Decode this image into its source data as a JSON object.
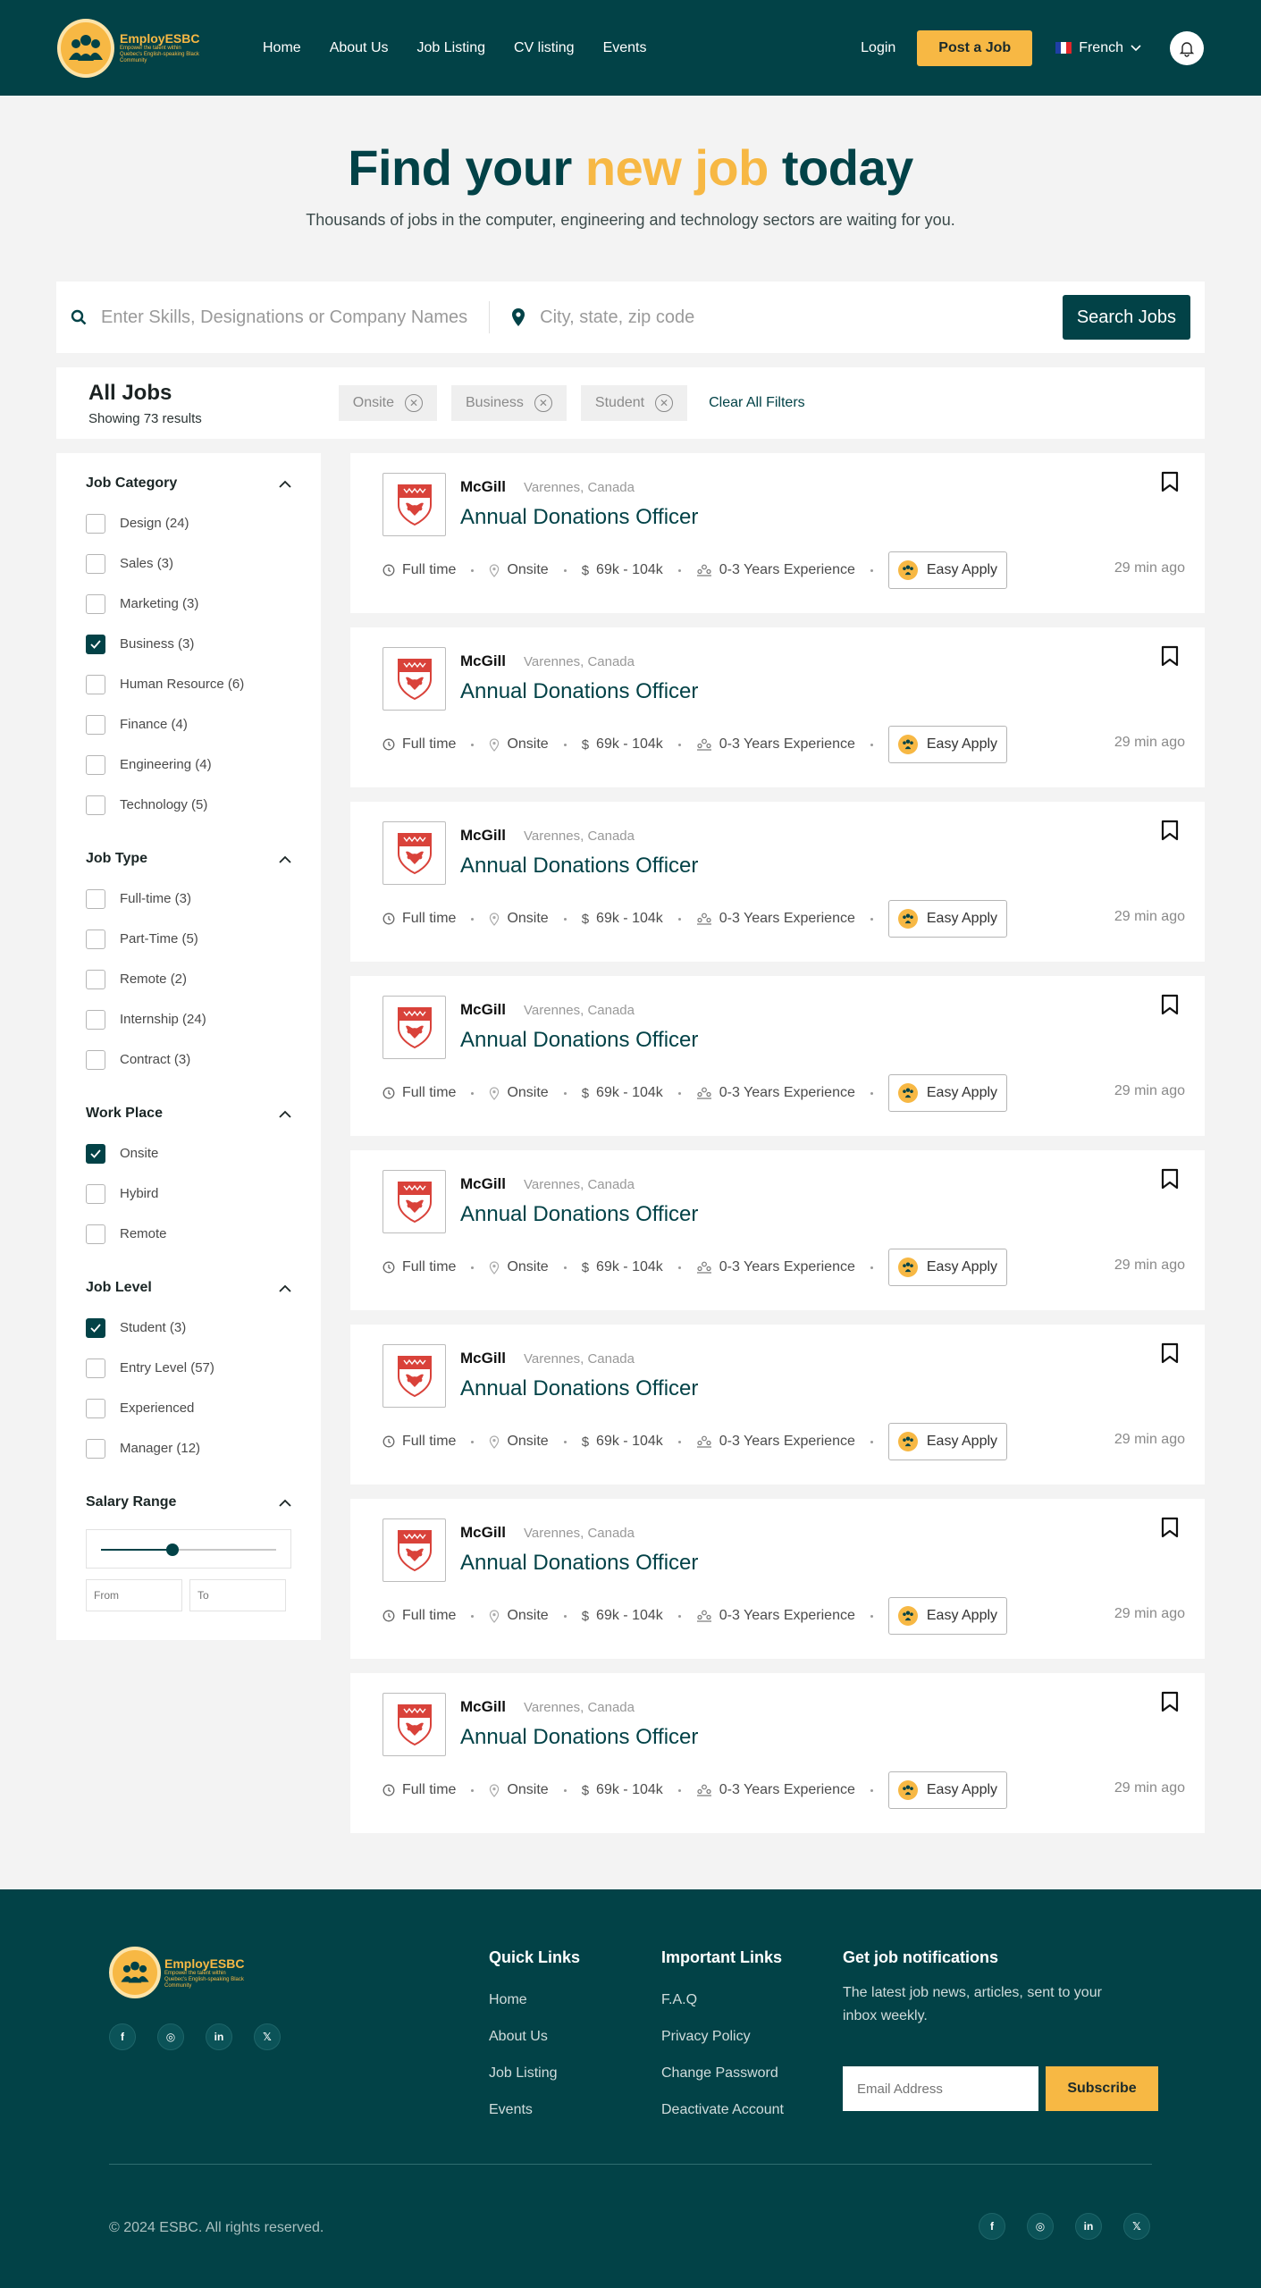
{
  "brand": {
    "name": "EmployESBC",
    "tagline": "Empower the talent within Quebec's English-speaking Black Community"
  },
  "nav": {
    "items": [
      "Home",
      "About Us",
      "Job Listing",
      "CV listing",
      "Events"
    ],
    "login": "Login",
    "post_job": "Post a Job",
    "language": "French"
  },
  "hero": {
    "title_part1": "Find your",
    "title_highlight": "new job",
    "title_part2": "today",
    "subtitle": "Thousands of jobs in the computer, engineering and technology sectors are waiting for you."
  },
  "search": {
    "keyword_placeholder": "Enter Skills, Designations or Company Names",
    "location_placeholder": "City, state, zip code",
    "button": "Search Jobs"
  },
  "results": {
    "title": "All Jobs",
    "count_text": "Showing 73 results",
    "active_filters": [
      "Onsite",
      "Business",
      "Student"
    ],
    "clear_label": "Clear All Filters"
  },
  "filters": [
    {
      "title": "Job Category",
      "items": [
        {
          "label": "Design (24)",
          "checked": false
        },
        {
          "label": "Sales (3)",
          "checked": false
        },
        {
          "label": "Marketing (3)",
          "checked": false
        },
        {
          "label": "Business (3)",
          "checked": true
        },
        {
          "label": "Human Resource (6)",
          "checked": false
        },
        {
          "label": "Finance (4)",
          "checked": false
        },
        {
          "label": "Engineering (4)",
          "checked": false
        },
        {
          "label": "Technology (5)",
          "checked": false
        }
      ]
    },
    {
      "title": "Job Type",
      "items": [
        {
          "label": "Full-time (3)",
          "checked": false
        },
        {
          "label": "Part-Time (5)",
          "checked": false
        },
        {
          "label": "Remote (2)",
          "checked": false
        },
        {
          "label": "Internship (24)",
          "checked": false
        },
        {
          "label": "Contract (3)",
          "checked": false
        }
      ]
    },
    {
      "title": "Work Place",
      "items": [
        {
          "label": "Onsite",
          "checked": true
        },
        {
          "label": "Hybird",
          "checked": false
        },
        {
          "label": "Remote",
          "checked": false
        }
      ]
    },
    {
      "title": "Job Level",
      "items": [
        {
          "label": "Student (3)",
          "checked": true
        },
        {
          "label": "Entry Level (57)",
          "checked": false
        },
        {
          "label": "Experienced",
          "checked": false
        },
        {
          "label": "Manager (12)",
          "checked": false
        }
      ]
    }
  ],
  "salary": {
    "title": "Salary Range",
    "slider_fraction": 0.41,
    "from_placeholder": "From",
    "to_placeholder": "To"
  },
  "jobs": [
    {
      "company": "McGill",
      "location": "Varennes, Canada",
      "title": "Annual Donations Officer",
      "type": "Full time",
      "workplace": "Onsite",
      "salary": "69k - 104k",
      "experience": "0-3 Years Experience",
      "apply": "Easy Apply",
      "posted": "29 min ago"
    },
    {
      "company": "McGill",
      "location": "Varennes, Canada",
      "title": "Annual Donations Officer",
      "type": "Full time",
      "workplace": "Onsite",
      "salary": "69k - 104k",
      "experience": "0-3 Years Experience",
      "apply": "Easy Apply",
      "posted": "29 min ago"
    },
    {
      "company": "McGill",
      "location": "Varennes, Canada",
      "title": "Annual Donations Officer",
      "type": "Full time",
      "workplace": "Onsite",
      "salary": "69k - 104k",
      "experience": "0-3 Years Experience",
      "apply": "Easy Apply",
      "posted": "29 min ago"
    },
    {
      "company": "McGill",
      "location": "Varennes, Canada",
      "title": "Annual Donations Officer",
      "type": "Full time",
      "workplace": "Onsite",
      "salary": "69k - 104k",
      "experience": "0-3 Years Experience",
      "apply": "Easy Apply",
      "posted": "29 min ago"
    },
    {
      "company": "McGill",
      "location": "Varennes, Canada",
      "title": "Annual Donations Officer",
      "type": "Full time",
      "workplace": "Onsite",
      "salary": "69k - 104k",
      "experience": "0-3 Years Experience",
      "apply": "Easy Apply",
      "posted": "29 min ago"
    },
    {
      "company": "McGill",
      "location": "Varennes, Canada",
      "title": "Annual Donations Officer",
      "type": "Full time",
      "workplace": "Onsite",
      "salary": "69k - 104k",
      "experience": "0-3 Years Experience",
      "apply": "Easy Apply",
      "posted": "29 min ago"
    },
    {
      "company": "McGill",
      "location": "Varennes, Canada",
      "title": "Annual Donations Officer",
      "type": "Full time",
      "workplace": "Onsite",
      "salary": "69k - 104k",
      "experience": "0-3 Years Experience",
      "apply": "Easy Apply",
      "posted": "29 min ago"
    },
    {
      "company": "McGill",
      "location": "Varennes, Canada",
      "title": "Annual Donations Officer",
      "type": "Full time",
      "workplace": "Onsite",
      "salary": "69k - 104k",
      "experience": "0-3 Years Experience",
      "apply": "Easy Apply",
      "posted": "29 min ago"
    }
  ],
  "footer": {
    "quick_links_title": "Quick Links",
    "quick_links": [
      "Home",
      "About Us",
      "Job Listing",
      "Events"
    ],
    "important_links_title": "Important Links",
    "important_links": [
      "F.A.Q",
      "Privacy Policy",
      "Change Password",
      "Deactivate Account"
    ],
    "notify_title": "Get job notifications",
    "notify_text": "The latest job news, articles, sent to your inbox weekly.",
    "email_placeholder": "Email Address",
    "subscribe": "Subscribe",
    "copyright": "© 2024 ESBC. All rights reserved.",
    "socials": [
      {
        "icon": "facebook-icon",
        "glyph": "f"
      },
      {
        "icon": "instagram-icon",
        "glyph": "◎"
      },
      {
        "icon": "linkedin-icon",
        "glyph": "in"
      },
      {
        "icon": "x-icon",
        "glyph": "𝕏"
      }
    ]
  },
  "colors": {
    "primary": "#024247",
    "accent": "#f7b844",
    "logo_red": "#d9423a"
  }
}
